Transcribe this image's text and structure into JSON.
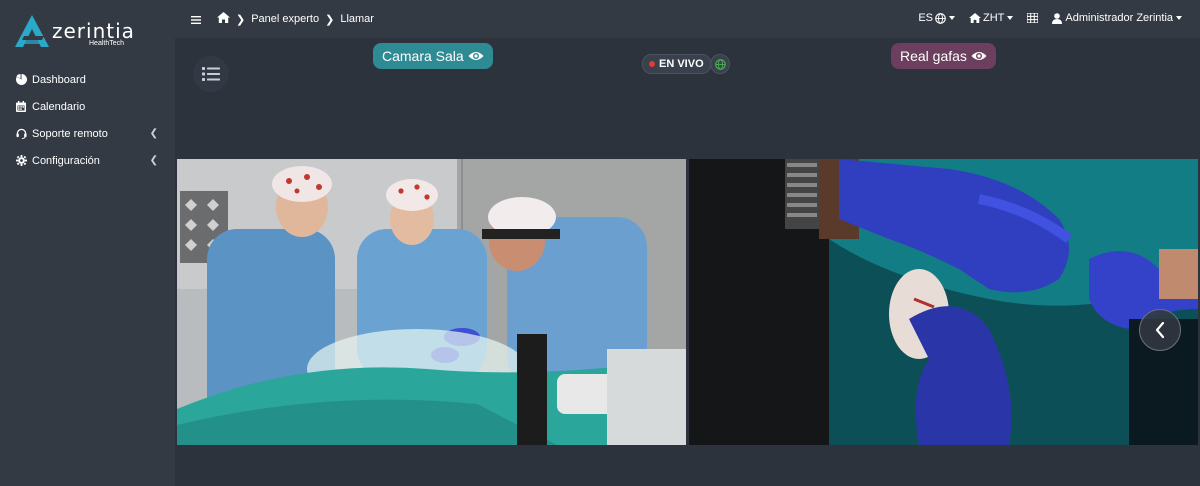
{
  "brand": {
    "name": "zerintia",
    "sub": "HealthTech"
  },
  "sidebar": {
    "items": [
      {
        "label": "Dashboard",
        "icon": "chart-pie-icon",
        "has_chevron": false
      },
      {
        "label": "Calendario",
        "icon": "calendar-icon",
        "has_chevron": false
      },
      {
        "label": "Soporte remoto",
        "icon": "headset-icon",
        "has_chevron": true
      },
      {
        "label": "Configuración",
        "icon": "gear-icon",
        "has_chevron": true
      }
    ]
  },
  "topbar": {
    "breadcrumb": [
      "Panel experto",
      "Llamar"
    ],
    "language": "ES",
    "organization": "ZHT",
    "user": "Administrador Zerintia"
  },
  "call": {
    "left_stream_label": "Camara Sala",
    "right_stream_label": "Real gafas",
    "live_label": "EN VIVO"
  },
  "colors": {
    "sidebar_bg": "#343a44",
    "main_bg": "#2d333d",
    "camera_pill": "#2e8a93",
    "glasses_pill": "#6b3f5d",
    "live_dot": "#e53935",
    "brand_accent": "#2aa9c9"
  },
  "icons": {
    "menu": "hamburger-icon",
    "home": "home-icon",
    "globe": "globe-icon",
    "grid": "grid-icon",
    "user": "user-icon",
    "eye": "eye-icon",
    "list": "list-icon",
    "next": "chevron-left-icon"
  }
}
